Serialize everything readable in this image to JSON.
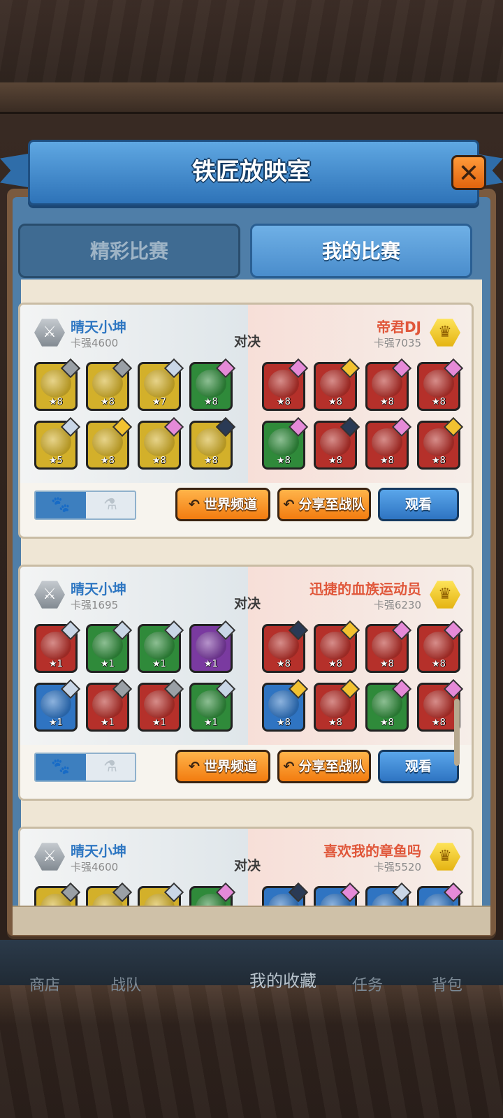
{
  "title": "铁匠放映室",
  "close_label": "✕",
  "tabs": [
    {
      "label": "精彩比赛",
      "active": false
    },
    {
      "label": "我的比赛",
      "active": true
    }
  ],
  "vs_label": "对决",
  "buttons": {
    "world": "世界频道",
    "team": "分享至战队",
    "watch": "观看"
  },
  "toggle": {
    "on_icon": "paw-icon",
    "off_icon": "potion-icon"
  },
  "matches": [
    {
      "left": {
        "name": "晴天小坤",
        "power": "卡强4600",
        "rank_icon": "silver-rank-icon"
      },
      "right": {
        "name": "帝君DJ",
        "power": "卡强7035",
        "rank_icon": "gold-crown-icon"
      },
      "left_units": [
        {
          "star": "★8",
          "color": "#d3b02a",
          "gem": "#9aa0a6"
        },
        {
          "star": "★8",
          "color": "#d3b02a",
          "gem": "#9aa0a6"
        },
        {
          "star": "★7",
          "color": "#d3b02a",
          "gem": "#c9d6e6"
        },
        {
          "star": "★8",
          "color": "#2f8a3a",
          "gem": "#e58ad8"
        },
        {
          "star": "★5",
          "color": "#d3b02a",
          "gem": "#c9d6e6"
        },
        {
          "star": "★8",
          "color": "#d3b02a",
          "gem": "#f2c230"
        },
        {
          "star": "★8",
          "color": "#d3b02a",
          "gem": "#e58ad8"
        },
        {
          "star": "★8",
          "color": "#d3b02a",
          "gem": "#2a3a55"
        }
      ],
      "right_units": [
        {
          "star": "★8",
          "color": "#b5302a",
          "gem": "#e58ad8"
        },
        {
          "star": "★8",
          "color": "#b5302a",
          "gem": "#f2c230"
        },
        {
          "star": "★8",
          "color": "#b5302a",
          "gem": "#e58ad8"
        },
        {
          "star": "★8",
          "color": "#b5302a",
          "gem": "#e58ad8"
        },
        {
          "star": "★8",
          "color": "#2f8a3a",
          "gem": "#e58ad8"
        },
        {
          "star": "★8",
          "color": "#b5302a",
          "gem": "#2a3a55"
        },
        {
          "star": "★8",
          "color": "#b5302a",
          "gem": "#e58ad8"
        },
        {
          "star": "★8",
          "color": "#b5302a",
          "gem": "#f2c230"
        }
      ]
    },
    {
      "left": {
        "name": "晴天小坤",
        "power": "卡强1695",
        "rank_icon": "silver-rank-icon"
      },
      "right": {
        "name": "迅捷的血族运动员",
        "power": "卡强6230",
        "rank_icon": "gold-crown-icon"
      },
      "left_units": [
        {
          "star": "★1",
          "color": "#b5302a",
          "gem": "#c9d6e6"
        },
        {
          "star": "★1",
          "color": "#2f8a3a",
          "gem": "#c9d6e6"
        },
        {
          "star": "★1",
          "color": "#2f8a3a",
          "gem": "#c9d6e6"
        },
        {
          "star": "★1",
          "color": "#7a3aa0",
          "gem": "#c9d6e6"
        },
        {
          "star": "★1",
          "color": "#2f74c2",
          "gem": "#c9d6e6"
        },
        {
          "star": "★1",
          "color": "#b5302a",
          "gem": "#9aa0a6"
        },
        {
          "star": "★1",
          "color": "#b5302a",
          "gem": "#9aa0a6"
        },
        {
          "star": "★1",
          "color": "#2f8a3a",
          "gem": "#c9d6e6"
        }
      ],
      "right_units": [
        {
          "star": "★8",
          "color": "#b5302a",
          "gem": "#2a3a55"
        },
        {
          "star": "★8",
          "color": "#b5302a",
          "gem": "#f2c230"
        },
        {
          "star": "★8",
          "color": "#b5302a",
          "gem": "#e58ad8"
        },
        {
          "star": "★8",
          "color": "#b5302a",
          "gem": "#e58ad8"
        },
        {
          "star": "★8",
          "color": "#2f74c2",
          "gem": "#f2c230"
        },
        {
          "star": "★8",
          "color": "#b5302a",
          "gem": "#f2c230"
        },
        {
          "star": "★8",
          "color": "#2f8a3a",
          "gem": "#e58ad8"
        },
        {
          "star": "★8",
          "color": "#b5302a",
          "gem": "#e58ad8"
        }
      ]
    },
    {
      "left": {
        "name": "晴天小坤",
        "power": "卡强4600",
        "rank_icon": "silver-rank-icon"
      },
      "right": {
        "name": "喜欢我的章鱼吗",
        "power": "卡强5520",
        "rank_icon": "gold-crown-icon"
      },
      "left_units": [
        {
          "star": "",
          "color": "#d3b02a",
          "gem": "#9aa0a6"
        },
        {
          "star": "",
          "color": "#d3b02a",
          "gem": "#9aa0a6"
        },
        {
          "star": "",
          "color": "#d3b02a",
          "gem": "#c9d6e6"
        },
        {
          "star": "",
          "color": "#2f8a3a",
          "gem": "#e58ad8"
        }
      ],
      "right_units": [
        {
          "star": "",
          "color": "#2f74c2",
          "gem": "#2a3a55"
        },
        {
          "star": "",
          "color": "#2f74c2",
          "gem": "#e58ad8"
        },
        {
          "star": "",
          "color": "#2f74c2",
          "gem": "#c9d6e6"
        },
        {
          "star": "",
          "color": "#2f74c2",
          "gem": "#e58ad8"
        }
      ]
    }
  ],
  "bottom_nav": [
    {
      "label": "商店"
    },
    {
      "label": "战队"
    },
    {
      "label": "我的收藏"
    },
    {
      "label": "任务"
    },
    {
      "label": "背包"
    }
  ]
}
